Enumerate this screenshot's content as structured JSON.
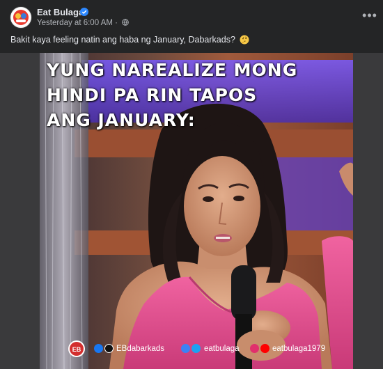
{
  "post": {
    "page_name": "Eat Bulaga",
    "timestamp": "Yesterday at 6:00 AM ·",
    "caption": "Bakit kaya feeling natin ang haba ng January, Dabarkads?",
    "caption_emoji": "thinking-face-emoji",
    "more_label": "•••",
    "image": {
      "meme_lines": [
        "YUNG NAREALIZE MONG",
        "HINDI PA RIN TAPOS",
        "ANG JANUARY:"
      ],
      "logo_text": "EB",
      "footer": {
        "facebook_tiktok": "EBdabarkads",
        "twitter": "eatbulaga",
        "instagram_youtube": "eatbulaga1979"
      }
    }
  },
  "colors": {
    "card_bg": "#242526",
    "verified": "#2d88ff",
    "text_primary": "#e4e6eb",
    "text_secondary": "#b0b3b8",
    "pink_dress": "#e3508f"
  }
}
